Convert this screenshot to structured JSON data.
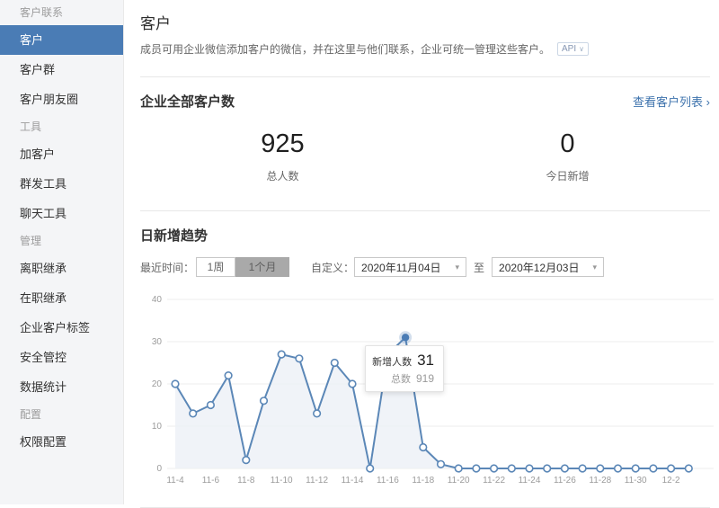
{
  "sidebar": {
    "sections": [
      {
        "header": "客户联系",
        "items": [
          {
            "label": "客户",
            "selected": true
          },
          {
            "label": "客户群",
            "selected": false
          },
          {
            "label": "客户朋友圈",
            "selected": false
          }
        ]
      },
      {
        "header": "工具",
        "items": [
          {
            "label": "加客户",
            "selected": false
          },
          {
            "label": "群发工具",
            "selected": false
          },
          {
            "label": "聊天工具",
            "selected": false
          }
        ]
      },
      {
        "header": "管理",
        "items": [
          {
            "label": "离职继承",
            "selected": false
          },
          {
            "label": "在职继承",
            "selected": false
          },
          {
            "label": "企业客户标签",
            "selected": false
          },
          {
            "label": "安全管控",
            "selected": false
          },
          {
            "label": "数据统计",
            "selected": false
          }
        ]
      },
      {
        "header": "配置",
        "items": [
          {
            "label": "权限配置",
            "selected": false
          }
        ]
      }
    ]
  },
  "header": {
    "title": "客户",
    "description": "成员可用企业微信添加客户的微信，并在这里与他们联系，企业可统一管理这些客户。",
    "api_badge": "API",
    "api_arrow": "∨"
  },
  "summary": {
    "title": "企业全部客户数",
    "link": "查看客户列表 ›",
    "stats": [
      {
        "value": "925",
        "label": "总人数"
      },
      {
        "value": "0",
        "label": "今日新增"
      }
    ]
  },
  "trend": {
    "title": "日新增趋势",
    "time_label": "最近时间：",
    "range_options": [
      {
        "label": "1周",
        "selected": false
      },
      {
        "label": "1个月",
        "selected": true
      }
    ],
    "custom_label": "自定义：",
    "date_from": "2020年11月04日",
    "to_label": "至",
    "date_to": "2020年12月03日",
    "select_arrow": "▾"
  },
  "chart_data": {
    "type": "line",
    "title": "日新增趋势",
    "x": [
      "11-4",
      "11-5",
      "11-6",
      "11-7",
      "11-8",
      "11-9",
      "11-10",
      "11-11",
      "11-12",
      "11-13",
      "11-14",
      "11-15",
      "11-16",
      "11-17",
      "11-18",
      "11-19",
      "11-20",
      "11-21",
      "11-22",
      "11-23",
      "11-24",
      "11-25",
      "11-26",
      "11-27",
      "11-28",
      "11-29",
      "11-30",
      "12-1",
      "12-2",
      "12-3"
    ],
    "series": [
      {
        "name": "新增人数",
        "values": [
          20,
          13,
          15,
          22,
          2,
          16,
          27,
          26,
          13,
          25,
          20,
          0,
          27,
          31,
          5,
          1,
          0,
          0,
          0,
          0,
          0,
          0,
          0,
          0,
          0,
          0,
          0,
          0,
          0,
          0
        ]
      }
    ],
    "ylim": [
      0,
      40
    ],
    "yticks": [
      0,
      10,
      20,
      30,
      40
    ],
    "x_tick_every": 2,
    "grid": true,
    "legend": "none",
    "highlight": {
      "x": "11-17",
      "index": 13,
      "tooltip": {
        "label1": "新增人数",
        "value1": "31",
        "label2": "总数",
        "value2": "919"
      }
    },
    "line_color": "#5b87b7",
    "fill_color": "#edf1f7",
    "grid_color": "#ececec",
    "tick_color": "#9b9b9b",
    "highlight_color": "#4a7cb5"
  },
  "colors": {
    "sidebar_bg": "#f4f5f7",
    "selected_blue": "#4a7cb5",
    "link_blue": "#3e73ad"
  }
}
